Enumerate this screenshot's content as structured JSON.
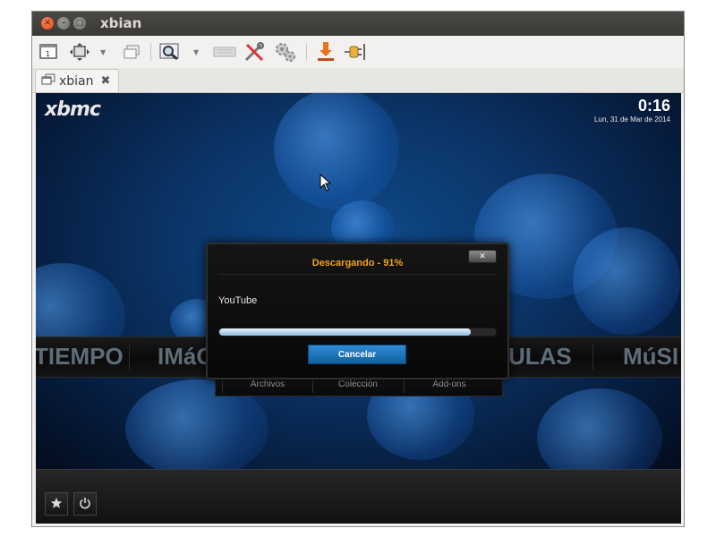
{
  "window": {
    "title": "xbian",
    "tab_label": "xbian",
    "tab_close_glyph": "✖"
  },
  "toolbar": {
    "icons": [
      "screen-icon",
      "fit-icon",
      "window-icon",
      "zoom-icon",
      "keyboard-icon",
      "tools-icon",
      "settings-icon",
      "download-icon",
      "plug-icon"
    ]
  },
  "xbmc": {
    "logo": "xbmc",
    "clock": "0:16",
    "date": "Lun, 31 de Mar de 2014",
    "menu": {
      "items": [
        "TIEMPO",
        "IMáG",
        "ULAS",
        "MúSI"
      ]
    },
    "submenu": {
      "items": [
        "Archivos",
        "Colección",
        "Add-ons"
      ]
    },
    "dialog": {
      "title": "Descargando - 91%",
      "close_glyph": "✕",
      "item": "YouTube",
      "progress_percent": 91,
      "cancel_label": "Cancelar"
    }
  },
  "colors": {
    "titlebar": "#3c3b37",
    "dialog_title": "#f0a31a",
    "cancel_button": "#1f78c4",
    "menu_text": "#5f6c7a"
  }
}
